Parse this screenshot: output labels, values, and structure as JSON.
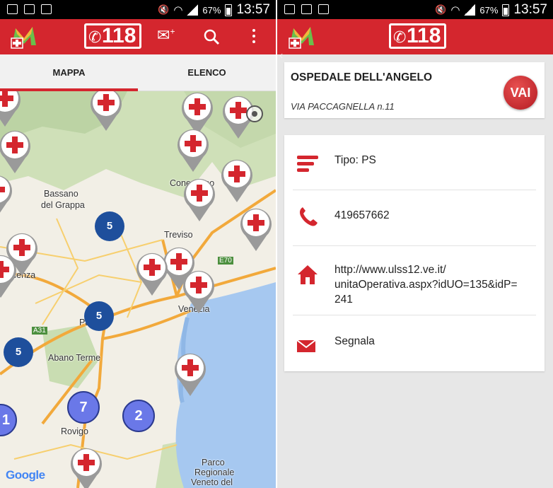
{
  "status_bar": {
    "battery": "67%",
    "time": "13:57"
  },
  "brand": {
    "number": "118",
    "red": "#d4262e"
  },
  "tabs": [
    {
      "label": "MAPPA",
      "active": true
    },
    {
      "label": "ELENCO",
      "active": false
    }
  ],
  "map": {
    "labels": [
      "Bassano",
      "del Grappa",
      "Treviso",
      "E70",
      "Vicenza",
      "Venezia",
      "Padova",
      "A31",
      "Abano Terme",
      "Rovigo",
      "Parco",
      "Regionale",
      "Veneto del",
      "Conegliano"
    ],
    "clusters": [
      "5",
      "5",
      "5",
      "7",
      "2",
      "1"
    ],
    "attribution": "Google"
  },
  "detail": {
    "name": "OSPEDALE DELL'ANGELO",
    "address": "VIA PACCAGNELLA n.11",
    "go_button": "VAI",
    "rows": [
      {
        "icon": "list-icon",
        "text": "Tipo: PS"
      },
      {
        "icon": "phone-icon",
        "text": "419657662"
      },
      {
        "icon": "home-icon",
        "text": "http://www.ulss12.ve.it/\nunitaOperativa.aspx?idUO=135&idP=\n241"
      },
      {
        "icon": "mail-icon",
        "text": "Segnala"
      }
    ]
  }
}
